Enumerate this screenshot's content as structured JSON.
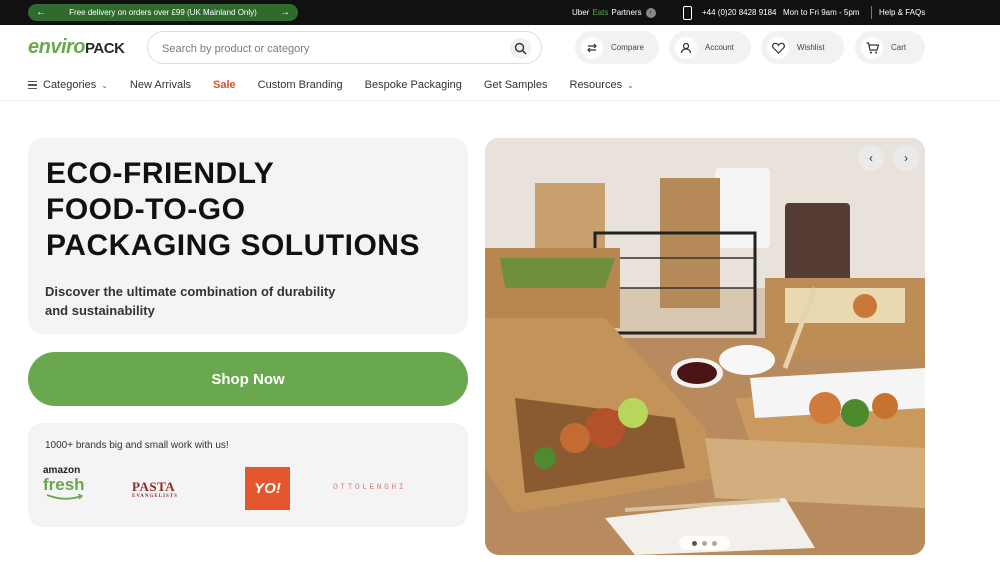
{
  "topbar": {
    "promo_text": "Free delivery on orders over £99 (UK Mainland Only)",
    "partner_prefix": "Uber",
    "partner_eats": "Eats",
    "partner_suffix": "Partners",
    "phone": "+44 (0)20 8428 9184",
    "hours": "Mon to Fri 9am - 5pm",
    "help": "Help & FAQs"
  },
  "header": {
    "logo_green": "enviro",
    "logo_dark": "PACK",
    "search_placeholder": "Search by product or category",
    "compare_label": "Compare",
    "account_label": "Account",
    "wishlist_label": "Wishlist",
    "cart_label": "Cart"
  },
  "nav": {
    "categories": "Categories",
    "new_arrivals": "New Arrivals",
    "sale": "Sale",
    "custom_branding": "Custom Branding",
    "bespoke_packaging": "Bespoke Packaging",
    "get_samples": "Get Samples",
    "resources": "Resources"
  },
  "hero": {
    "title_line1": "ECO-FRIENDLY",
    "title_line2": "FOOD-TO-GO",
    "title_line3": "PACKAGING SOLUTIONS",
    "subtitle_line1": "Discover the ultimate combination of durability",
    "subtitle_line2": "and sustainability",
    "cta": "Shop Now"
  },
  "brands": {
    "text": "1000+ brands big and small work with us!",
    "amazon_top": "amazon",
    "amazon_bottom": "fresh",
    "pasta": "PASTA",
    "pasta_sub": "EVANGELISTS",
    "yo": "YO!",
    "ottolenghi": "OTTOLENGHI"
  },
  "carousel": {
    "prev_icon": "chevron-left-icon",
    "next_icon": "chevron-right-icon",
    "slides": 3,
    "active_slide": 1
  },
  "colors": {
    "brand_green": "#6aa84f",
    "sale_red": "#d9532c",
    "topbar_bg": "#111111",
    "promo_green": "#2f6b2f"
  }
}
